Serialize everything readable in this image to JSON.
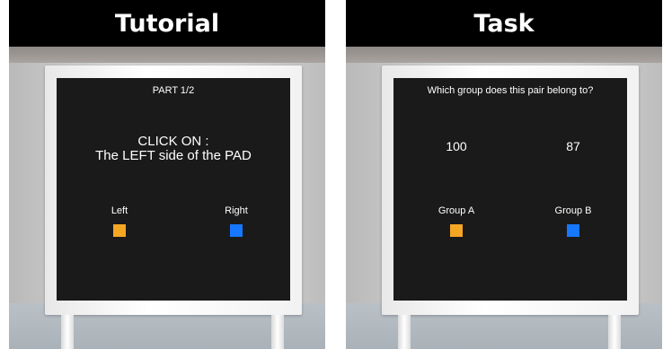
{
  "tutorial": {
    "header": "Tutorial",
    "part": "PART 1/2",
    "instruction_line1": "CLICK ON :",
    "instruction_line2": "The LEFT side of the PAD",
    "left_label": "Left",
    "right_label": "Right"
  },
  "task": {
    "header": "Task",
    "question": "Which group does this pair belong to?",
    "value_left": "100",
    "value_right": "87",
    "left_label": "Group A",
    "right_label": "Group B"
  },
  "colors": {
    "left_option": "#f5a623",
    "right_option": "#1677ff"
  }
}
